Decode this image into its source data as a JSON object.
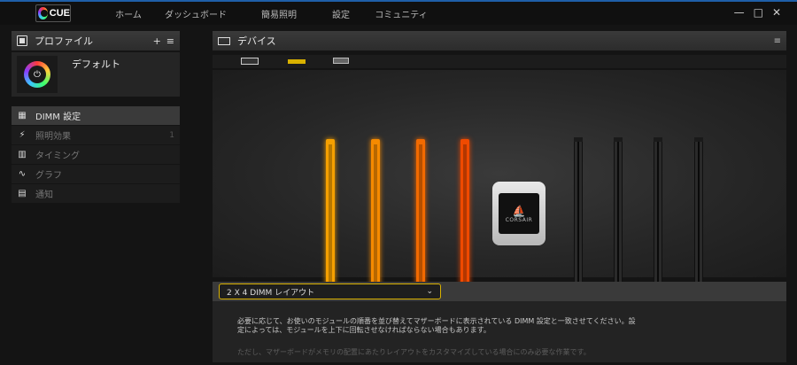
{
  "app": {
    "logo_text": "CUE"
  },
  "nav": {
    "items": [
      "ホーム",
      "ダッシュボード",
      "簡易照明",
      "設定",
      "コミュニティ"
    ]
  },
  "window_controls": {
    "minimize": "—",
    "maximize": "□",
    "close": "✕"
  },
  "profiles_panel": {
    "title": "プロファイル",
    "add_label": "+",
    "menu_label": "≡",
    "profile_name": "デフォルト"
  },
  "menu": {
    "items": [
      {
        "label": "DIMM 設定",
        "icon": "dimm-icon",
        "active": true
      },
      {
        "label": "照明効果",
        "icon": "lightning-icon",
        "count": "1"
      },
      {
        "label": "タイミング",
        "icon": "memory-icon"
      },
      {
        "label": "グラフ",
        "icon": "graph-icon"
      },
      {
        "label": "通知",
        "icon": "chat-icon"
      }
    ]
  },
  "devices_panel": {
    "title": "デバイス",
    "menu_label": "≡"
  },
  "cooler": {
    "brand": "CORSAIR"
  },
  "dimm_colors": [
    "#f5a000",
    "#f58a00",
    "#f26a00",
    "#ef4a00"
  ],
  "layout_select": {
    "value": "2 X 4 DIMM レイアウト"
  },
  "info": {
    "line1": "必要に応じて、お使いのモジュールの順番を並び替えてマザーボードに表示されている DIMM 設定と一致させてください。設定によっては、モジュールを上下に回転させなければならない場合もあります。",
    "note": "ただし、マザーボードがメモリの配置にあたりレイアウトをカスタマイズしている場合にのみ必要な作業です。"
  }
}
